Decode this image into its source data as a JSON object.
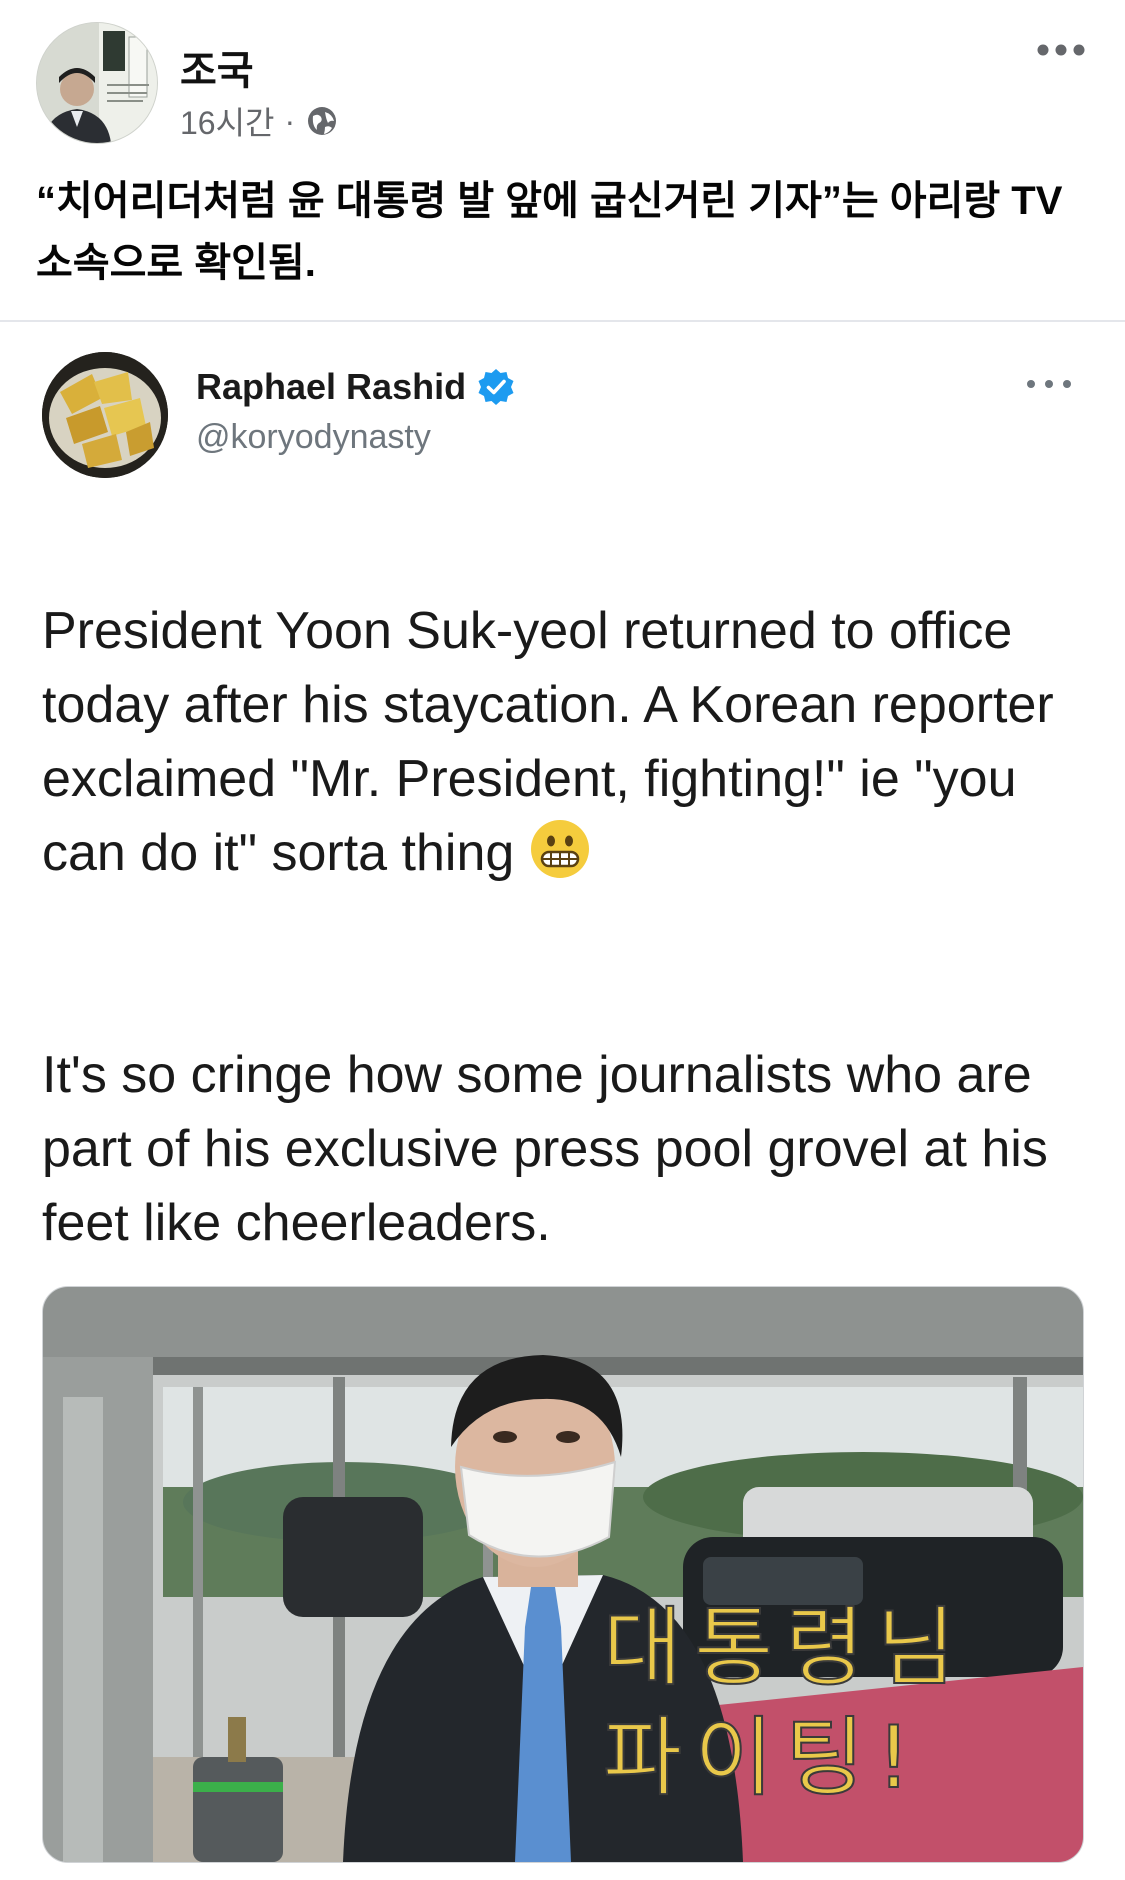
{
  "post": {
    "author_name": "조국",
    "time": "16시간",
    "separator": "·",
    "privacy_icon": "globe-icon",
    "more_icon": "ellipsis-icon",
    "text": "“치어리더처럼 윤 대통령 발 앞에 굽신거린 기자”는 아리랑 TV 소속으로 확인됨."
  },
  "tweet": {
    "author_name": "Raphael Rashid",
    "verified_icon": "verified-badge-icon",
    "handle": "@koryodynasty",
    "more_icon": "ellipsis-icon",
    "paragraph_1": "President Yoon Suk-yeol returned to office today after his staycation. A Korean reporter exclaimed \"Mr. President, fighting!\" ie \"you can do it\" sorta thing",
    "emoji": "grimacing-face-emoji",
    "paragraph_2": "It's so cringe how some journalists who are part of his exclusive press pool grovel at his feet like cheerleaders.",
    "media": {
      "caption_line_1": "대통령님",
      "caption_line_2": "파이팅!"
    }
  },
  "colors": {
    "meta_gray": "#65676b",
    "verified_blue": "#1d9bf0",
    "caption_yellow": "#e9c84a"
  }
}
